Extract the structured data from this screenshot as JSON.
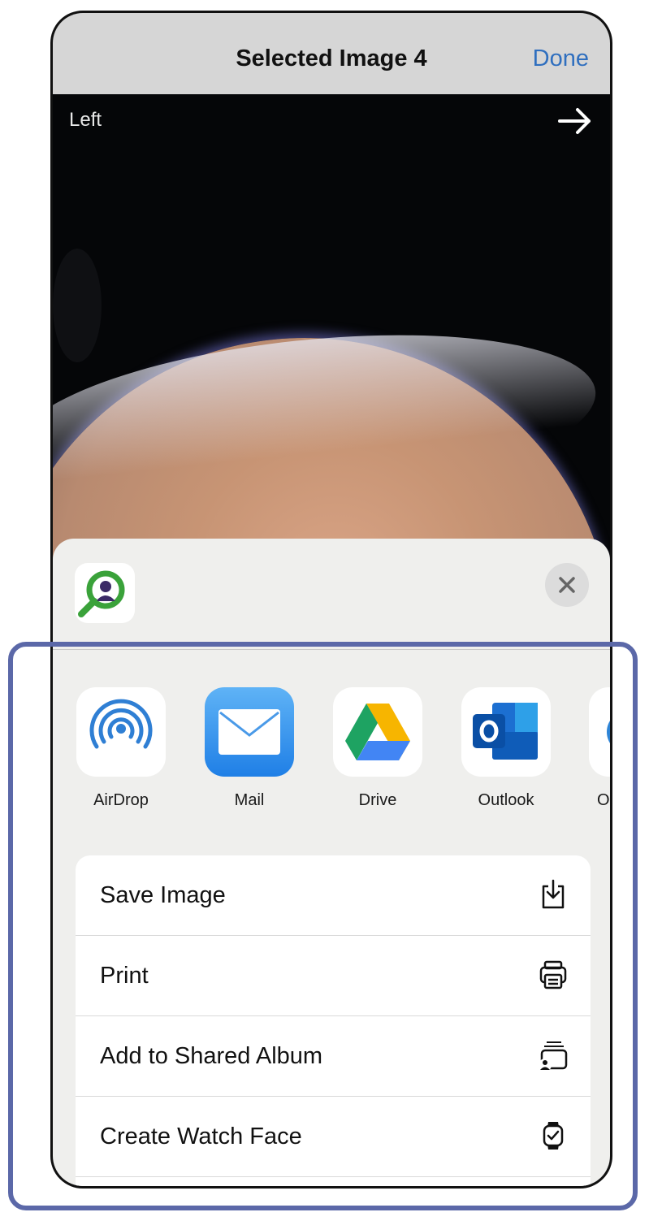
{
  "navbar": {
    "title": "Selected Image 4",
    "done_label": "Done"
  },
  "photo": {
    "eye_label": "Left"
  },
  "share_sheet": {
    "apps": [
      {
        "label": "AirDrop",
        "icon": "airdrop-icon"
      },
      {
        "label": "Mail",
        "icon": "mail-icon"
      },
      {
        "label": "Drive",
        "icon": "google-drive-icon"
      },
      {
        "label": "Outlook",
        "icon": "outlook-icon"
      },
      {
        "label": "O",
        "icon": "partial-app-icon"
      }
    ],
    "actions": [
      {
        "label": "Save Image",
        "icon": "save-download-icon"
      },
      {
        "label": "Print",
        "icon": "printer-icon"
      },
      {
        "label": "Add to Shared Album",
        "icon": "shared-album-icon"
      },
      {
        "label": "Create Watch Face",
        "icon": "watch-icon"
      }
    ]
  },
  "colors": {
    "accent": "#2f6fbf",
    "highlight_frame": "#5b68a8",
    "sheet_bg": "#efefed"
  }
}
